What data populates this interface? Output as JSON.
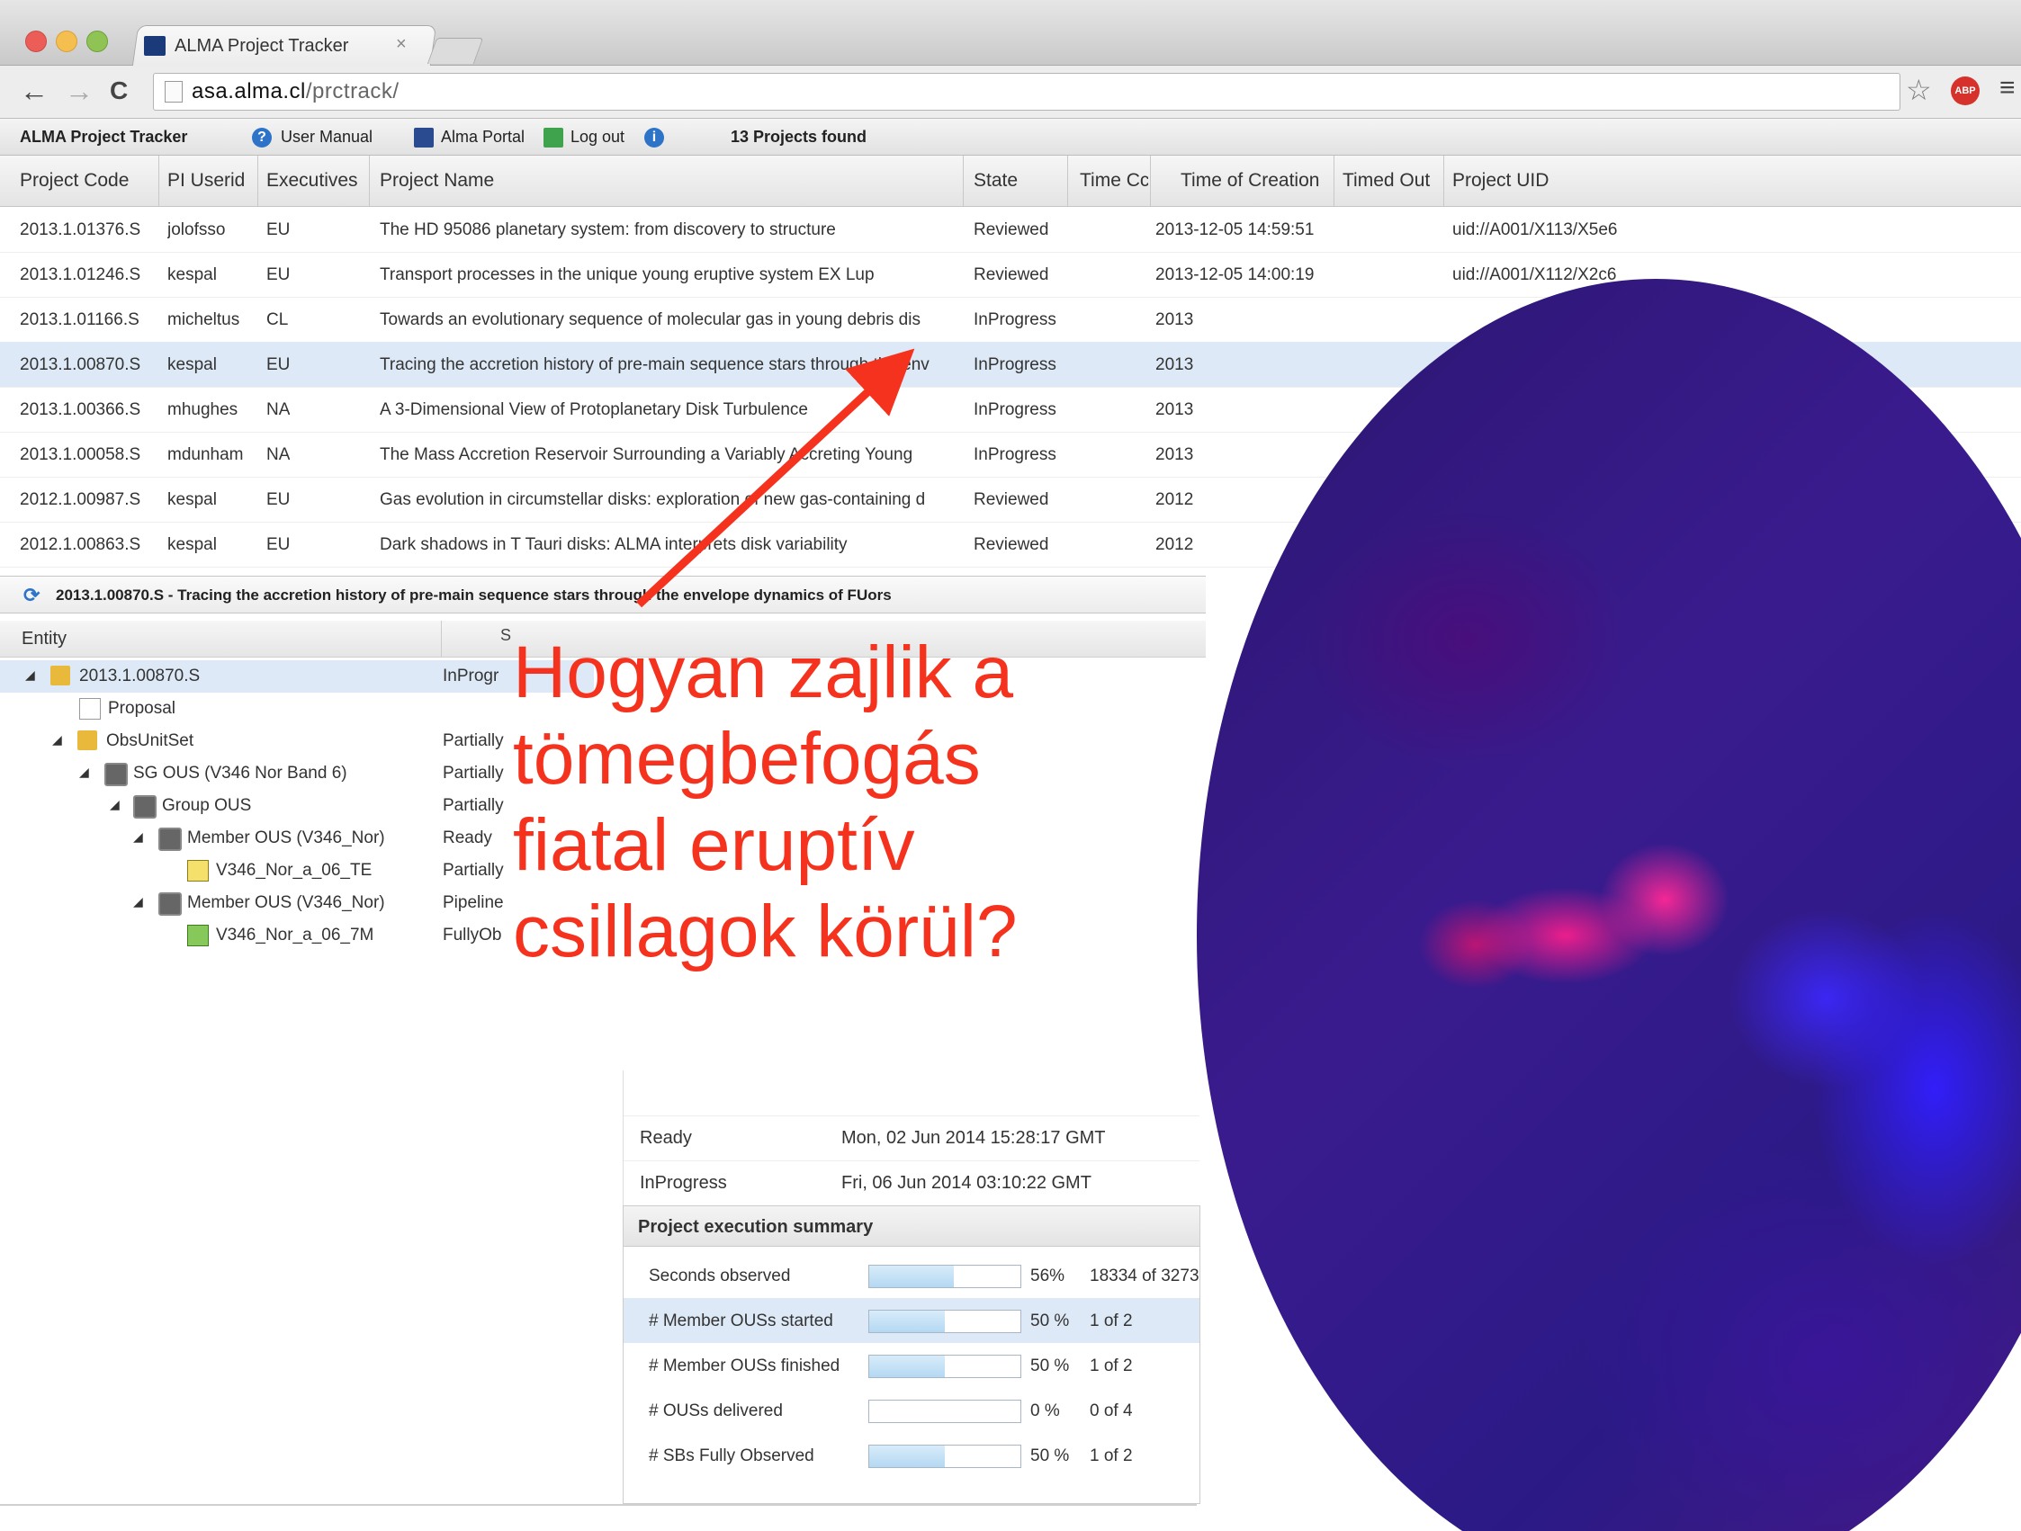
{
  "browser": {
    "tab_title": "ALMA Project Tracker",
    "tab_close": "×",
    "url_host": "asa.alma.cl",
    "url_path": "/prctrack/",
    "back": "←",
    "forward": "→",
    "reload": "C",
    "star": "☆",
    "abp": "ABP",
    "menu": "≡"
  },
  "toolbar": {
    "app_title": "ALMA Project Tracker",
    "help_icon": "?",
    "manual": "User Manual",
    "portal": "Alma Portal",
    "logout": "Log out",
    "info_icon": "i",
    "found": "13 Projects found"
  },
  "grid": {
    "columns": [
      "Project Code",
      "PI Userid",
      "Executives",
      "Project Name",
      "State",
      "Time Cc",
      "Time of Creation",
      "Timed Out",
      "Project UID"
    ],
    "rows": [
      {
        "code": "2013.1.01376.S",
        "pi": "jolofsso",
        "exec": "EU",
        "name": "The HD 95086 planetary system: from discovery to structure",
        "state": "Reviewed",
        "created": "2013-12-05 14:59:51",
        "uid": "uid://A001/X113/X5e6"
      },
      {
        "code": "2013.1.01246.S",
        "pi": "kespal",
        "exec": "EU",
        "name": "Transport processes in the unique young eruptive system EX Lup",
        "state": "Reviewed",
        "created": "2013-12-05 14:00:19",
        "uid": "uid://A001/X112/X2c6"
      },
      {
        "code": "2013.1.01166.S",
        "pi": "micheltus",
        "exec": "CL",
        "name": "Towards an evolutionary sequence of molecular gas in young debris dis",
        "state": "InProgress",
        "created": "2013",
        "uid": ""
      },
      {
        "code": "2013.1.00870.S",
        "pi": "kespal",
        "exec": "EU",
        "name": "Tracing the accretion history of pre-main sequence stars through the env",
        "state": "InProgress",
        "created": "2013",
        "uid": ""
      },
      {
        "code": "2013.1.00366.S",
        "pi": "mhughes",
        "exec": "NA",
        "name": "A 3-Dimensional View of Protoplanetary Disk Turbulence",
        "state": "InProgress",
        "created": "2013",
        "uid": ""
      },
      {
        "code": "2013.1.00058.S",
        "pi": "mdunham",
        "exec": "NA",
        "name": "The Mass Accretion Reservoir Surrounding a Variably Accreting Young",
        "state": "InProgress",
        "created": "2013",
        "uid": ""
      },
      {
        "code": "2012.1.00987.S",
        "pi": "kespal",
        "exec": "EU",
        "name": "Gas evolution in circumstellar disks: exploration of new gas-containing d",
        "state": "Reviewed",
        "created": "2012",
        "uid": ""
      },
      {
        "code": "2012.1.00863.S",
        "pi": "kespal",
        "exec": "EU",
        "name": "Dark shadows in T Tauri disks: ALMA interprets disk variability",
        "state": "Reviewed",
        "created": "2012",
        "uid": ""
      }
    ]
  },
  "detail": {
    "refresh_icon": "⟳",
    "title": "2013.1.00870.S - Tracing the accretion history of pre-main sequence stars through the envelope dynamics of FUors",
    "tree_header": "Entity",
    "tree_header_mark": "S"
  },
  "tree": [
    {
      "label": "2013.1.00870.S",
      "state": "InProgr",
      "expander": "◢"
    },
    {
      "label": "Proposal",
      "state": "",
      "expander": ""
    },
    {
      "label": "ObsUnitSet",
      "state": "Partially",
      "expander": "◢"
    },
    {
      "label": "SG OUS (V346 Nor Band 6)",
      "state": "Partially",
      "expander": "◢"
    },
    {
      "label": "Group OUS",
      "state": "Partially",
      "expander": "◢"
    },
    {
      "label": "Member OUS (V346_Nor)",
      "state": "Ready",
      "expander": "◢"
    },
    {
      "label": "V346_Nor_a_06_TE",
      "state": "Partially",
      "expander": ""
    },
    {
      "label": "Member OUS (V346_Nor)",
      "state": "Pipeline",
      "expander": "◢"
    },
    {
      "label": "V346_Nor_a_06_7M",
      "state": "FullyOb",
      "expander": ""
    }
  ],
  "state_history": [
    {
      "state": "Ready",
      "date": "Mon, 02 Jun 2014 15:28:17 GMT"
    },
    {
      "state": "InProgress",
      "date": "Fri, 06 Jun 2014 03:10:22 GMT"
    }
  ],
  "summary": {
    "title": "Project execution summary",
    "rows": [
      {
        "label": "Seconds observed",
        "pct_text": "56%",
        "fraction": 0.56,
        "count": "18334 of 3273"
      },
      {
        "label": "# Member OUSs started",
        "pct_text": "50 %",
        "fraction": 0.5,
        "count": "1 of 2"
      },
      {
        "label": "# Member OUSs finished",
        "pct_text": "50 %",
        "fraction": 0.5,
        "count": "1 of 2"
      },
      {
        "label": "# OUSs delivered",
        "pct_text": "0 %",
        "fraction": 0.0,
        "count": "0 of 4"
      },
      {
        "label": "# SBs Fully Observed",
        "pct_text": "50 %",
        "fraction": 0.5,
        "count": "1 of 2"
      }
    ]
  },
  "annotation": {
    "line1": "Hogyan zajlik a",
    "line2": "tömegbefogás",
    "line3": "fiatal eruptív",
    "line4": "csillagok körül?",
    "color": "#f5321e"
  },
  "colors": {
    "selection": "#dde9f6",
    "arrow": "#f5321e"
  }
}
